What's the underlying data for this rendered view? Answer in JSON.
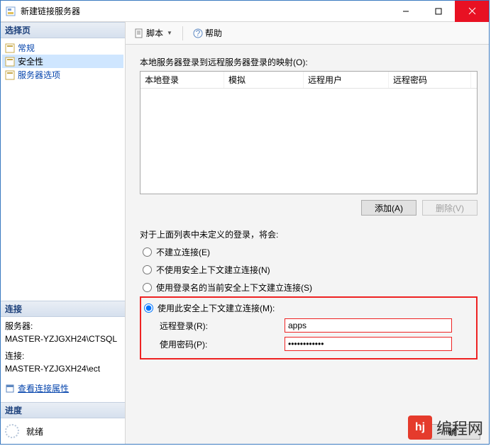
{
  "titlebar": {
    "title": "新建链接服务器"
  },
  "left": {
    "select_hdr": "选择页",
    "items": [
      {
        "label": "常规",
        "selected": false
      },
      {
        "label": "安全性",
        "selected": true
      },
      {
        "label": "服务器选项",
        "selected": false
      }
    ],
    "conn_hdr": "连接",
    "server_lbl": "服务器:",
    "server_val": "MASTER-YZJGXH24\\CTSQL",
    "connect_lbl": "连接:",
    "connect_val": "MASTER-YZJGXH24\\ect",
    "view_conn": "查看连接属性",
    "prog_hdr": "进度",
    "prog_status": "就绪"
  },
  "toolbar": {
    "script": "脚本",
    "help": "帮助"
  },
  "content": {
    "map_label": "本地服务器登录到远程服务器登录的映射(O):",
    "grid_headers": {
      "c1": "本地登录",
      "c2": "模拟",
      "c3": "远程用户",
      "c4": "远程密码"
    },
    "add_btn": "添加(A)",
    "del_btn": "删除(V)",
    "opts_label": "对于上面列表中未定义的登录，将会:",
    "radios": {
      "r1": "不建立连接(E)",
      "r2": "不使用安全上下文建立连接(N)",
      "r3": "使用登录名的当前安全上下文建立连接(S)",
      "r4": "使用此安全上下文建立连接(M):"
    },
    "remote_login_lbl": "远程登录(R):",
    "remote_login_val": "apps",
    "password_lbl": "使用密码(P):",
    "password_val": "••••••••••••",
    "ok_btn": "确"
  },
  "watermark": {
    "logo": "hj",
    "text": "编程网"
  }
}
